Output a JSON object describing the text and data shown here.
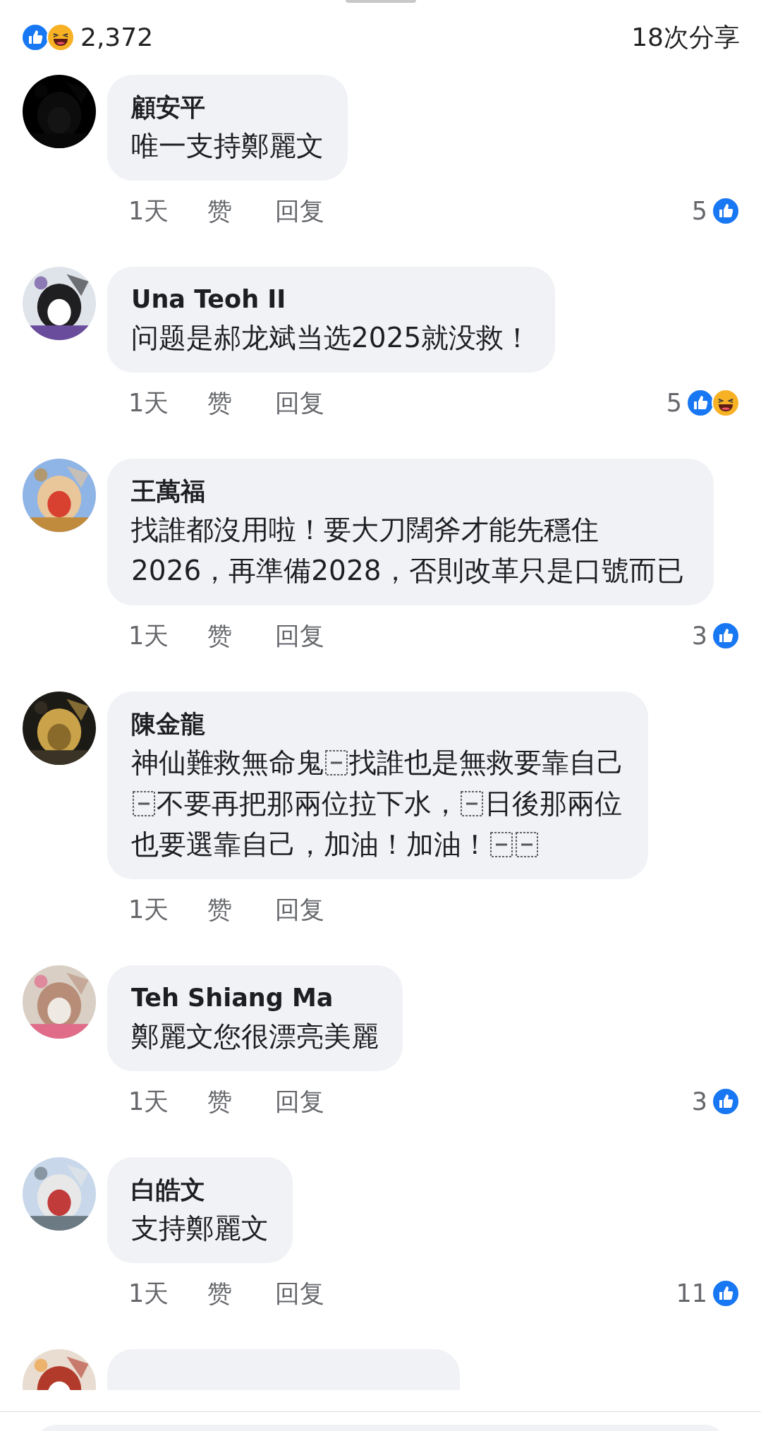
{
  "summary": {
    "reactions": [
      {
        "kind": "like"
      },
      {
        "kind": "haha"
      }
    ],
    "reaction_count": "2,372",
    "shares": "18次分享"
  },
  "comments": [
    {
      "name": "顧安平",
      "text": "唯一支持鄭麗文",
      "time": "1天",
      "like": "赞",
      "reply": "回复",
      "like_count": "5",
      "reactions": [
        {
          "kind": "like"
        }
      ]
    },
    {
      "name": "Una Teoh II",
      "text": "问题是郝龙斌当选2025就没救！",
      "time": "1天",
      "like": "赞",
      "reply": "回复",
      "like_count": "5",
      "reactions": [
        {
          "kind": "like"
        },
        {
          "kind": "haha"
        }
      ]
    },
    {
      "name": "王萬福",
      "text": "找誰都沒用啦！要大刀闊斧才能先穩住2026，再準備2028，否則改革只是口號而已",
      "time": "1天",
      "like": "赞",
      "reply": "回复",
      "like_count": "3",
      "reactions": [
        {
          "kind": "like"
        }
      ]
    },
    {
      "name": "陳金龍",
      "lines": [
        [
          {
            "kind": "text",
            "text": "神仙難救無命鬼"
          },
          {
            "kind": "object"
          },
          {
            "kind": "text",
            "text": "找誰也是無救要靠自己"
          }
        ],
        [
          {
            "kind": "object"
          },
          {
            "kind": "text",
            "text": "不要再把那兩位拉下水，"
          },
          {
            "kind": "object"
          },
          {
            "kind": "text",
            "text": "日後那兩位"
          }
        ],
        [
          {
            "kind": "text",
            "text": "也要選靠自己，加油！加油！"
          },
          {
            "kind": "object"
          },
          {
            "kind": "object"
          }
        ]
      ],
      "time": "1天",
      "like": "赞",
      "reply": "回复"
    },
    {
      "name": "Teh Shiang Ma",
      "text": "鄭麗文您很漂亮美麗",
      "time": "1天",
      "like": "赞",
      "reply": "回复",
      "like_count": "3",
      "reactions": [
        {
          "kind": "like"
        }
      ]
    },
    {
      "name": "白皓文",
      "text": "支持鄭麗文",
      "time": "1天",
      "like": "赞",
      "reply": "回复",
      "like_count": "11",
      "reactions": [
        {
          "kind": "like"
        }
      ]
    }
  ]
}
